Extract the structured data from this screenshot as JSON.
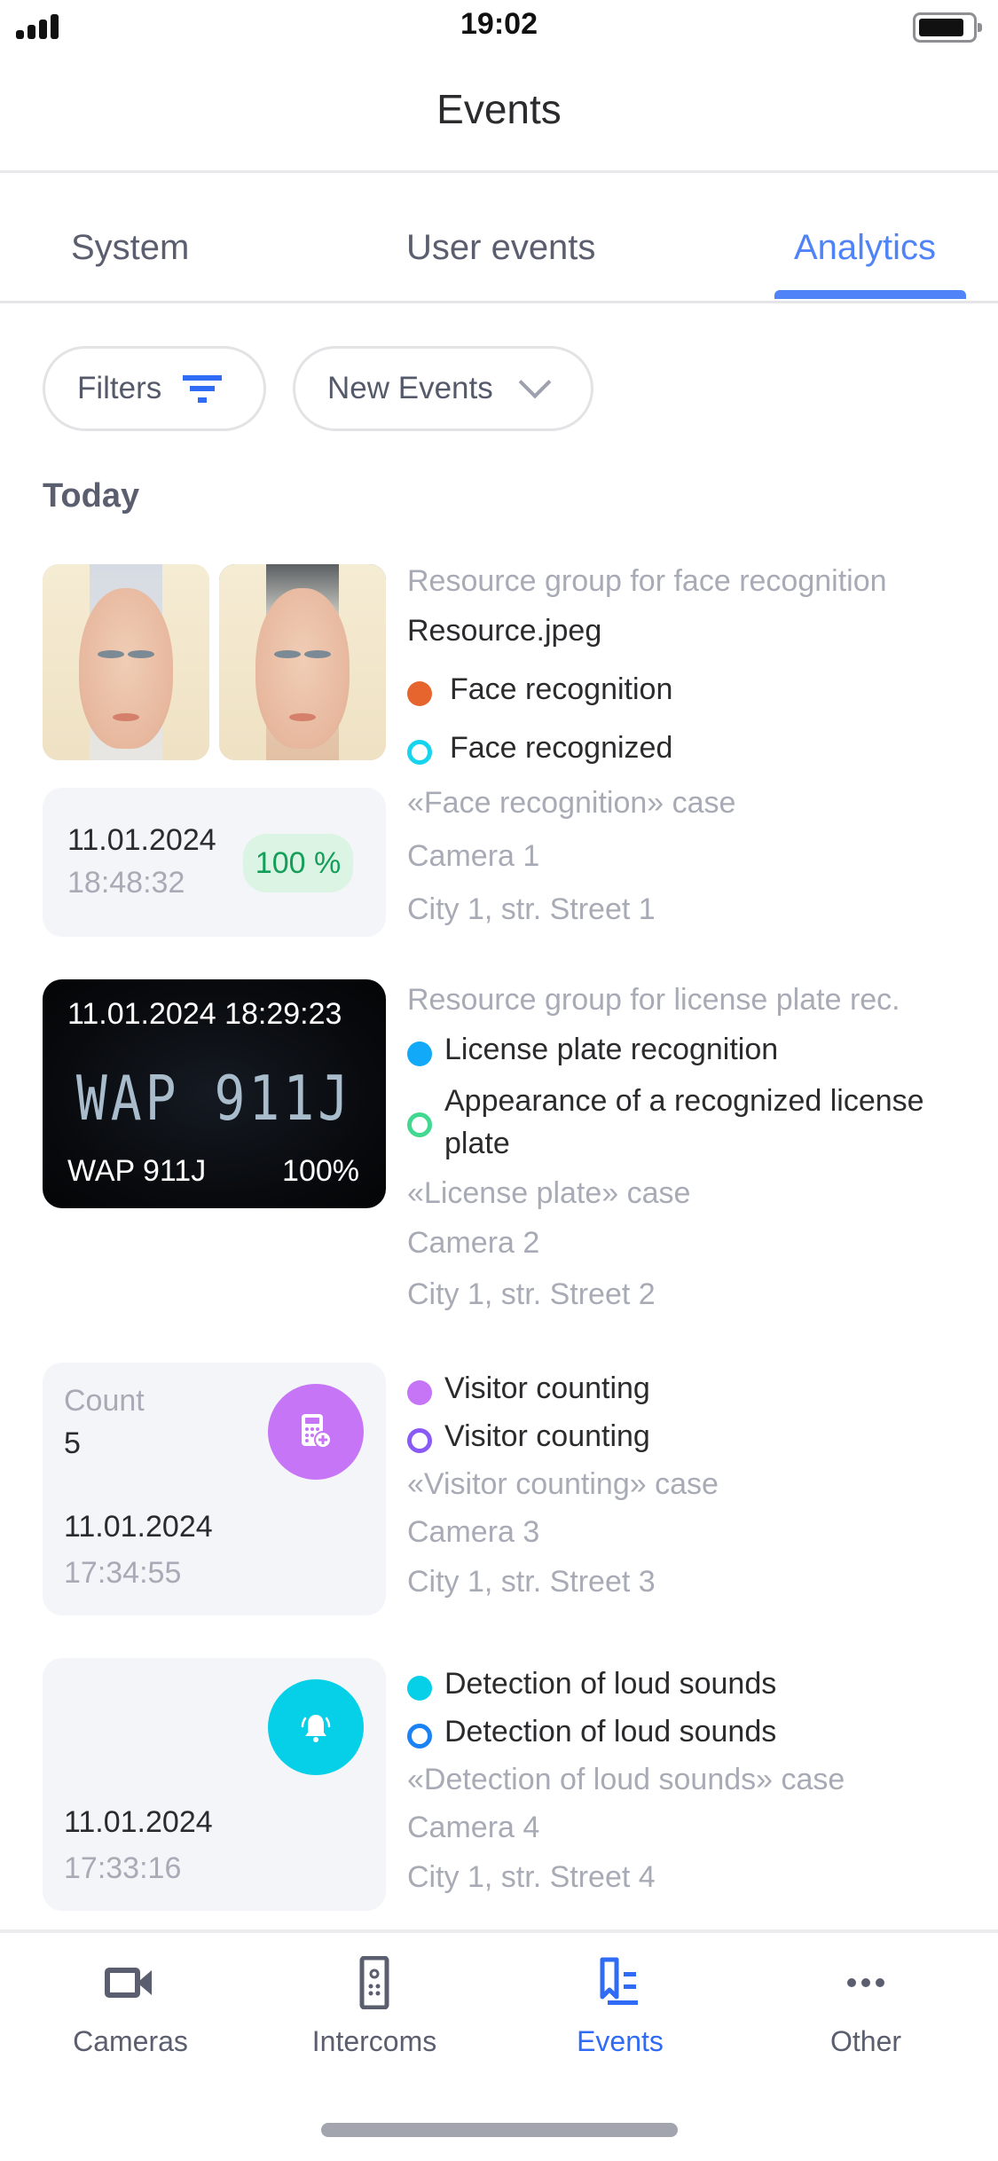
{
  "status_bar": {
    "time": "19:02",
    "signal_icon": "cellular-signal-icon",
    "battery_icon": "battery-icon"
  },
  "header": {
    "title": "Events"
  },
  "tabs": [
    {
      "label": "System",
      "active": false
    },
    {
      "label": "User events",
      "active": false
    },
    {
      "label": "Analytics",
      "active": true
    }
  ],
  "filters": {
    "filters_label": "Filters",
    "filters_icon": "filter-lines-icon",
    "dropdown_selected": "New Events",
    "dropdown_icon": "chevron-down-icon"
  },
  "section_title": "Today",
  "colors": {
    "accent": "#4f83f7",
    "face_recognition": "#e6652f",
    "face_recognized": "#16d3ee",
    "license_plate_recognition": "#12a9f8",
    "recognized_plate": "#43d88f",
    "visitor_counting": "#c775f7",
    "visitor_counting_ring": "#8a5af7",
    "loud_sounds": "#06cfe8",
    "loud_sounds_ring": "#1a82f5",
    "percent_badge_bg": "#dbf4e3",
    "percent_badge_text": "#149e5a"
  },
  "events": [
    {
      "type": "face",
      "resource_group": "Resource group for face recognition",
      "resource_file": "Resource.jpeg",
      "analytics": "Face recognition",
      "event": "Face recognized",
      "case": "«Face recognition» case",
      "camera": "Camera 1",
      "address": "City 1, str. Street 1",
      "date": "11.01.2024",
      "time": "18:48:32",
      "confidence": "100 %"
    },
    {
      "type": "plate",
      "resource_group": "Resource group for license plate rec.",
      "analytics": "License plate recognition",
      "event_line1": "Appearance of a recognized license",
      "event_line2": "plate",
      "case": "«License plate» case",
      "camera": "Camera 2",
      "address": "City 1, str. Street 2",
      "timestamp": "11.01.2024 18:29:23",
      "plate_image_text": "WAP 911J",
      "plate_number": "WAP 911J",
      "confidence": "100%"
    },
    {
      "type": "counter",
      "count_label": "Count",
      "count_value": "5",
      "icon": "calculator-icon",
      "analytics": "Visitor counting",
      "event": "Visitor counting",
      "case": "«Visitor counting» case",
      "camera": "Camera 3",
      "address": "City 1, str. Street 3",
      "date": "11.01.2024",
      "time": "17:34:55"
    },
    {
      "type": "sound",
      "icon": "bell-icon",
      "analytics": "Detection of loud sounds",
      "event": "Detection of loud sounds",
      "case": "«Detection of loud sounds» case",
      "camera": "Camera 4",
      "address": "City 1, str. Street 4",
      "date": "11.01.2024",
      "time": "17:33:16"
    }
  ],
  "bottom_nav": [
    {
      "label": "Cameras",
      "icon": "video-camera-icon",
      "active": false
    },
    {
      "label": "Intercoms",
      "icon": "intercom-icon",
      "active": false
    },
    {
      "label": "Events",
      "icon": "events-list-icon",
      "active": true
    },
    {
      "label": "Other",
      "icon": "more-dots-icon",
      "active": false
    }
  ]
}
